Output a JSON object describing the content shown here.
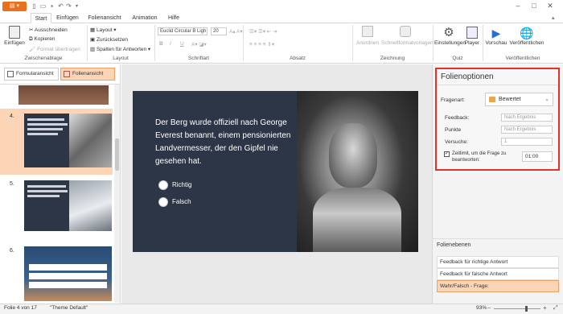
{
  "titlebar": {
    "app_menu_icon": "menu-icon"
  },
  "tabs": [
    "Start",
    "Einfügen",
    "Folienansicht",
    "Animation",
    "Hilfe"
  ],
  "ribbon": {
    "clipboard": {
      "paste": "Einfügen",
      "cut": "Ausschneiden",
      "copy": "Kopieren",
      "format": "Format übertragen",
      "group": "Zwischenablage"
    },
    "layout": {
      "layout": "Layout",
      "reset": "Zurücksetzen",
      "columns": "Spalten für Antworten",
      "group": "Layout"
    },
    "font": {
      "family": "Euclid Circular B Ligh",
      "size": "20",
      "bold": "B",
      "italic": "I",
      "underline": "U",
      "group": "Schriftart"
    },
    "paragraph": {
      "group": "Absatz"
    },
    "drawing": {
      "arrange": "Anordnen",
      "styles": "Schnellformatvorlagen",
      "group": "Zeichnung"
    },
    "quiz": {
      "settings": "Einstellungen",
      "player": "Player",
      "group": "Quiz"
    },
    "publish": {
      "preview": "Vorschau",
      "publish": "Veröffentlichen",
      "group": "Veröffentlichen"
    }
  },
  "leftpane": {
    "form_view": "Formularansicht",
    "slide_view": "Folienansicht",
    "thumbs": [
      {
        "num": "4."
      },
      {
        "num": "5."
      },
      {
        "num": "6."
      }
    ]
  },
  "slide": {
    "question": "Der Berg wurde offiziell nach George Everest benannt, einem pensionierten Landvermesser, der den Gipfel nie gesehen hat.",
    "options": [
      "Richtig",
      "Falsch"
    ]
  },
  "options_panel": {
    "title": "Folienoptionen",
    "question_type_label": "Fragenart:",
    "question_type": "Bewertet",
    "feedback_label": "Feedback:",
    "feedback_value": "Nach Ergebnis",
    "points_label": "Punkte",
    "points_value": "Nach Ergebnis",
    "attempts_label": "Versuche:",
    "attempts_value": "1",
    "time_limit_label": "Zeitlimit, um die Frage zu beantworten:",
    "time_limit_value": "01:00"
  },
  "layers_panel": {
    "title": "Folienebenen",
    "layers": [
      "Feedback für richtige Antwort",
      "Feedback für falsche Antwort",
      "Wahr/Falsch - Frage:"
    ]
  },
  "status": {
    "slide": "Folie 4 von 17",
    "theme": "\"Theme Default\"",
    "zoom": "93%",
    "zoom_level": 0.93
  },
  "colors": {
    "accent": "#e9701e",
    "slide_bg": "#2d3646",
    "highlight": "#fcd4b6",
    "options_border": "#e0332a"
  }
}
